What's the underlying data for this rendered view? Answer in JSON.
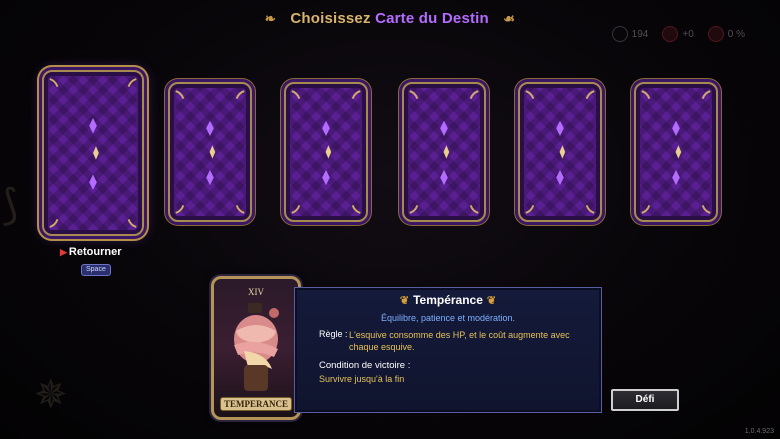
{
  "header": {
    "title_prefix": "Choisissez",
    "title_highlight": "Carte du Destin"
  },
  "stats": {
    "resource_1": "194",
    "resource_2": "+0",
    "resource_3": "0 %"
  },
  "cards": {
    "count": 6,
    "selected_index": 0,
    "flip_label": "Retourner",
    "flip_key": "Space"
  },
  "info_panel": {
    "card_numeral": "XIV",
    "card_banner": "TEMPERANCE",
    "name": "Tempérance",
    "subtitle": "Équilibre, patience et modération.",
    "rule_label": "Règle :",
    "rule_text": "L'esquive consomme des HP, et le coût augmente avec chaque esquive.",
    "victory_label": "Condition de victoire :",
    "victory_text": "Survivre jusqu'à la fin"
  },
  "actions": {
    "challenge_label": "Défi"
  },
  "footer": {
    "version": "1.0.4.923"
  },
  "colors": {
    "title_gold": "#d9b46a",
    "title_purple": "#b46cff",
    "card_purple": "#5a1f92",
    "card_frame": "#a78a4f",
    "rule_gold": "#e6c25a",
    "subtitle_blue": "#7fb0ff"
  }
}
